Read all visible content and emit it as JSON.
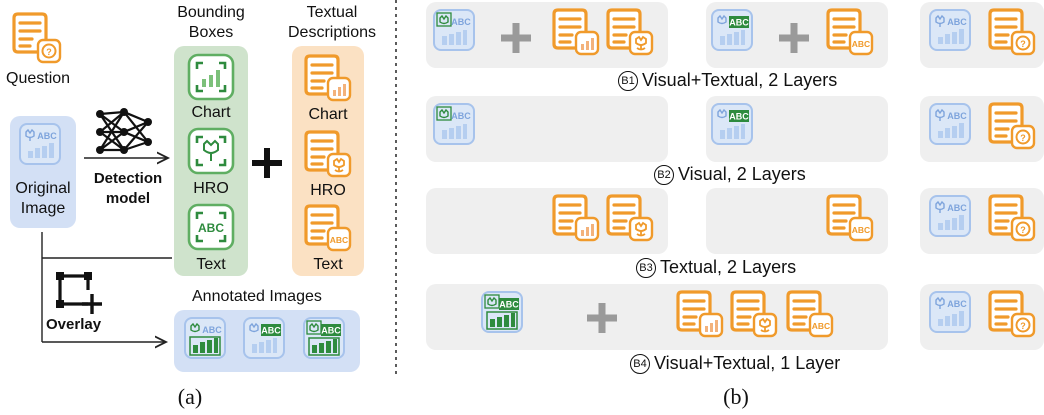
{
  "panel_a": {
    "question_label": "Question",
    "original_image_label": [
      "Original",
      "Image"
    ],
    "bounding_boxes_header": [
      "Bounding",
      "Boxes"
    ],
    "textual_descriptions_header": [
      "Textual",
      "Descriptions"
    ],
    "detection_model_label": [
      "Detection",
      "model"
    ],
    "box_labels": [
      "Chart",
      "HRO",
      "Text"
    ],
    "desc_labels": [
      "Chart",
      "HRO",
      "Text"
    ],
    "overlay_label": "Overlay",
    "annotated_images_label": "Annotated Images",
    "caption": "(a)"
  },
  "panel_b": {
    "caption": "(b)",
    "rows": [
      {
        "marker": "B1",
        "title": "Visual+Textual, 2 Layers"
      },
      {
        "marker": "B2",
        "title": "Visual, 2 Layers"
      },
      {
        "marker": "B3",
        "title": "Textual, 2 Layers"
      },
      {
        "marker": "B4",
        "title": "Visual+Textual, 1 Layer"
      }
    ]
  },
  "icon_text": {
    "abc": "ABC"
  },
  "colors": {
    "green": "#2e8b3e",
    "green_light": "#d9ead7",
    "orange": "#f09a2b",
    "orange_light": "#fbe3c8",
    "blue": "#8fb5ea",
    "blue_light": "#d8e4f6",
    "gray_row": "#efefef"
  }
}
